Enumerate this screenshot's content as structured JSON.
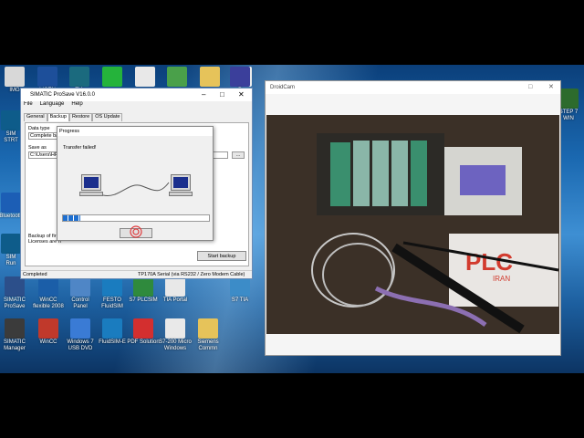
{
  "desktop": {
    "top_icons": [
      {
        "label": "IMG",
        "icon": "folder-icon",
        "color": "#d8d8d8"
      },
      {
        "label": "LICEN",
        "icon": "license-icon",
        "color": "#1d4f9a"
      },
      {
        "label": "TIA",
        "icon": "tia-portal-icon",
        "color": "#1b6a7e"
      },
      {
        "label": "",
        "icon": "whatsapp-icon",
        "color": "#25b33b"
      },
      {
        "label": "",
        "icon": "document-icon",
        "color": "#e8e8e8"
      },
      {
        "label": "",
        "icon": "app-icon",
        "color": "#4aa04a"
      },
      {
        "label": "",
        "icon": "folder-icon",
        "color": "#e6c35a"
      },
      {
        "label": "",
        "icon": "file-icon",
        "color": "#ececec"
      },
      {
        "label": "P",
        "icon": "p-app-icon",
        "color": "#3b3f9b"
      }
    ],
    "left_icons": [
      {
        "label": "SIM\nSTRT",
        "icon": "simatic-icon",
        "color": "#0e5c8a"
      },
      {
        "label": "Bluetooth",
        "icon": "bluetooth-icon",
        "color": "#1c5eb5"
      },
      {
        "label": "SIM\nRun",
        "icon": "simatic-icon",
        "color": "#0e5c8a"
      }
    ],
    "right_icons": [
      {
        "label": "STEP 7\nWIN",
        "icon": "step7-icon",
        "color": "#2d6b2d"
      }
    ],
    "bottom_row1": [
      {
        "label": "SIMATIC\nProSave",
        "icon": "prosave-icon",
        "color": "#2c4f8a"
      },
      {
        "label": "WinCC\nflexible 2008",
        "icon": "wincc-icon",
        "color": "#1b5ea8"
      },
      {
        "label": "Control\nPanel",
        "icon": "control-panel-icon",
        "color": "#4f86c6"
      },
      {
        "label": "FESTO\nFluidSIM",
        "icon": "festo-icon",
        "color": "#1a7cbf"
      },
      {
        "label": "S7 PLCSIM",
        "icon": "plcsim-icon",
        "color": "#2f8a3d"
      },
      {
        "label": "TIA Portal",
        "icon": "tia-icon",
        "color": "#e8e8e8"
      },
      {
        "label": "S7 TIA",
        "icon": "s7tia-icon",
        "color": "#3c8cc8"
      }
    ],
    "bottom_row2": [
      {
        "label": "SIMATIC\nManager",
        "icon": "simatic-manager-icon",
        "color": "#3b3b3b"
      },
      {
        "label": "WinCC",
        "icon": "wincc-flex-icon",
        "color": "#c0392b"
      },
      {
        "label": "Windows 7\nUSB DVD",
        "icon": "usb-dvd-icon",
        "color": "#3a7bd5"
      },
      {
        "label": "FluidSIM-E",
        "icon": "fluidsim-icon",
        "color": "#1a7cbf"
      },
      {
        "label": "PDF Solution",
        "icon": "pdf-icon",
        "color": "#d32f2f"
      },
      {
        "label": "S7-200 Micro\nWindows",
        "icon": "microwin-icon",
        "color": "#e9e9e9"
      },
      {
        "label": "Siemens\nCommn",
        "icon": "folder-icon",
        "color": "#e6c35a"
      }
    ]
  },
  "prosave": {
    "title": "SIMATIC ProSave V16.0.0",
    "menu": [
      "File",
      "Language",
      "Help"
    ],
    "tabs": [
      "General",
      "Backup",
      "Restore",
      "OS Update"
    ],
    "data_type_label": "Data type",
    "data_type_value": "Complete bac",
    "save_as_label": "Save as",
    "save_as_value": "C:\\Users\\HP",
    "browse_label": "...",
    "info_line1": "Backup of firm",
    "info_line2": "Licenses are n",
    "start_backup": "Start backup",
    "status_left": "Completed",
    "status_port": "TP170A  Serial (via RS232 / Zero Modem Cable)"
  },
  "progress": {
    "title": "Progress",
    "message": "Transfer failed!",
    "ok_label": ""
  },
  "droidcam": {
    "title": "DroidCam",
    "brand": "PLC",
    "brand_sub": "IRAN"
  }
}
